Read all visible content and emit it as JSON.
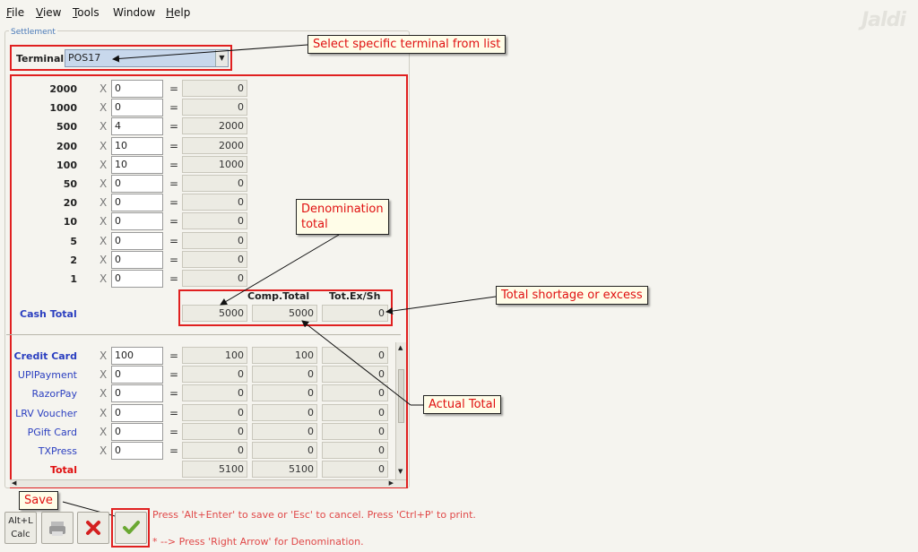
{
  "menu": [
    {
      "label": "File",
      "u": "F",
      "rest": "ile"
    },
    {
      "label": "View",
      "u": "V",
      "rest": "iew"
    },
    {
      "label": "Tools",
      "u": "T",
      "rest": "ools"
    },
    {
      "label": "Window",
      "u": "",
      "rest": "Window"
    },
    {
      "label": "Help",
      "u": "H",
      "rest": "elp"
    }
  ],
  "logo_text": "Jaldi",
  "settlement": {
    "legend": "Settlement",
    "terminal_label": "Terminal",
    "terminal_value": "POS17"
  },
  "denominations": [
    {
      "label": "2000",
      "x": "X",
      "qty": "0",
      "eq": "=",
      "amount": "0"
    },
    {
      "label": "1000",
      "x": "X",
      "qty": "0",
      "eq": "=",
      "amount": "0"
    },
    {
      "label": "500",
      "x": "X",
      "qty": "4",
      "eq": "=",
      "amount": "2000"
    },
    {
      "label": "200",
      "x": "X",
      "qty": "10",
      "eq": "=",
      "amount": "2000"
    },
    {
      "label": "100",
      "x": "X",
      "qty": "10",
      "eq": "=",
      "amount": "1000"
    },
    {
      "label": "50",
      "x": "X",
      "qty": "0",
      "eq": "=",
      "amount": "0"
    },
    {
      "label": "20",
      "x": "X",
      "qty": "0",
      "eq": "=",
      "amount": "0"
    },
    {
      "label": "10",
      "x": "X",
      "qty": "0",
      "eq": "=",
      "amount": "0"
    },
    {
      "label": "5",
      "x": "X",
      "qty": "0",
      "eq": "=",
      "amount": "0"
    },
    {
      "label": "2",
      "x": "X",
      "qty": "0",
      "eq": "=",
      "amount": "0"
    },
    {
      "label": "1",
      "x": "X",
      "qty": "0",
      "eq": "=",
      "amount": "0"
    }
  ],
  "cash_total": {
    "label": "Cash Total",
    "comp_header": "Comp.Total",
    "exsh_header": "Tot.Ex/Sh",
    "denom_total": "5000",
    "comp_total": "5000",
    "ex_sh": "0"
  },
  "payments": [
    {
      "label": "Credit Card",
      "bold": true,
      "x": "X",
      "qty": "100",
      "eq": "=",
      "amount": "100",
      "comp": "100",
      "exsh": "0"
    },
    {
      "label": "UPIPayment",
      "bold": false,
      "x": "X",
      "qty": "0",
      "eq": "=",
      "amount": "0",
      "comp": "0",
      "exsh": "0"
    },
    {
      "label": "RazorPay",
      "bold": false,
      "x": "X",
      "qty": "0",
      "eq": "=",
      "amount": "0",
      "comp": "0",
      "exsh": "0"
    },
    {
      "label": "LRV Voucher",
      "bold": false,
      "x": "X",
      "qty": "0",
      "eq": "=",
      "amount": "0",
      "comp": "0",
      "exsh": "0"
    },
    {
      "label": "PGift Card",
      "bold": false,
      "x": "X",
      "qty": "0",
      "eq": "=",
      "amount": "0",
      "comp": "0",
      "exsh": "0"
    },
    {
      "label": "TXPress",
      "bold": false,
      "x": "X",
      "qty": "0",
      "eq": "=",
      "amount": "0",
      "comp": "0",
      "exsh": "0"
    }
  ],
  "grand_total": {
    "label": "Total",
    "amount": "5100",
    "comp": "5100",
    "exsh": "0"
  },
  "callouts": {
    "terminal": "Select specific terminal from list",
    "denomination": "Denomination\ntotal",
    "shortage": "Total shortage or excess",
    "actual": "Actual Total",
    "save": "Save"
  },
  "toolbar": {
    "altl_line1": "Alt+L",
    "altl_line2": "Calc"
  },
  "hints": {
    "line1": "Press 'Alt+Enter' to save or 'Esc' to cancel. Press 'Ctrl+P' to print.",
    "line2": "* --> Press 'Right Arrow' for Denomination."
  },
  "colors": {
    "accent_red": "#e02020",
    "label_blue": "#2b3fc0",
    "legend_blue": "#4a7ab8",
    "save_green": "#6aa832"
  }
}
